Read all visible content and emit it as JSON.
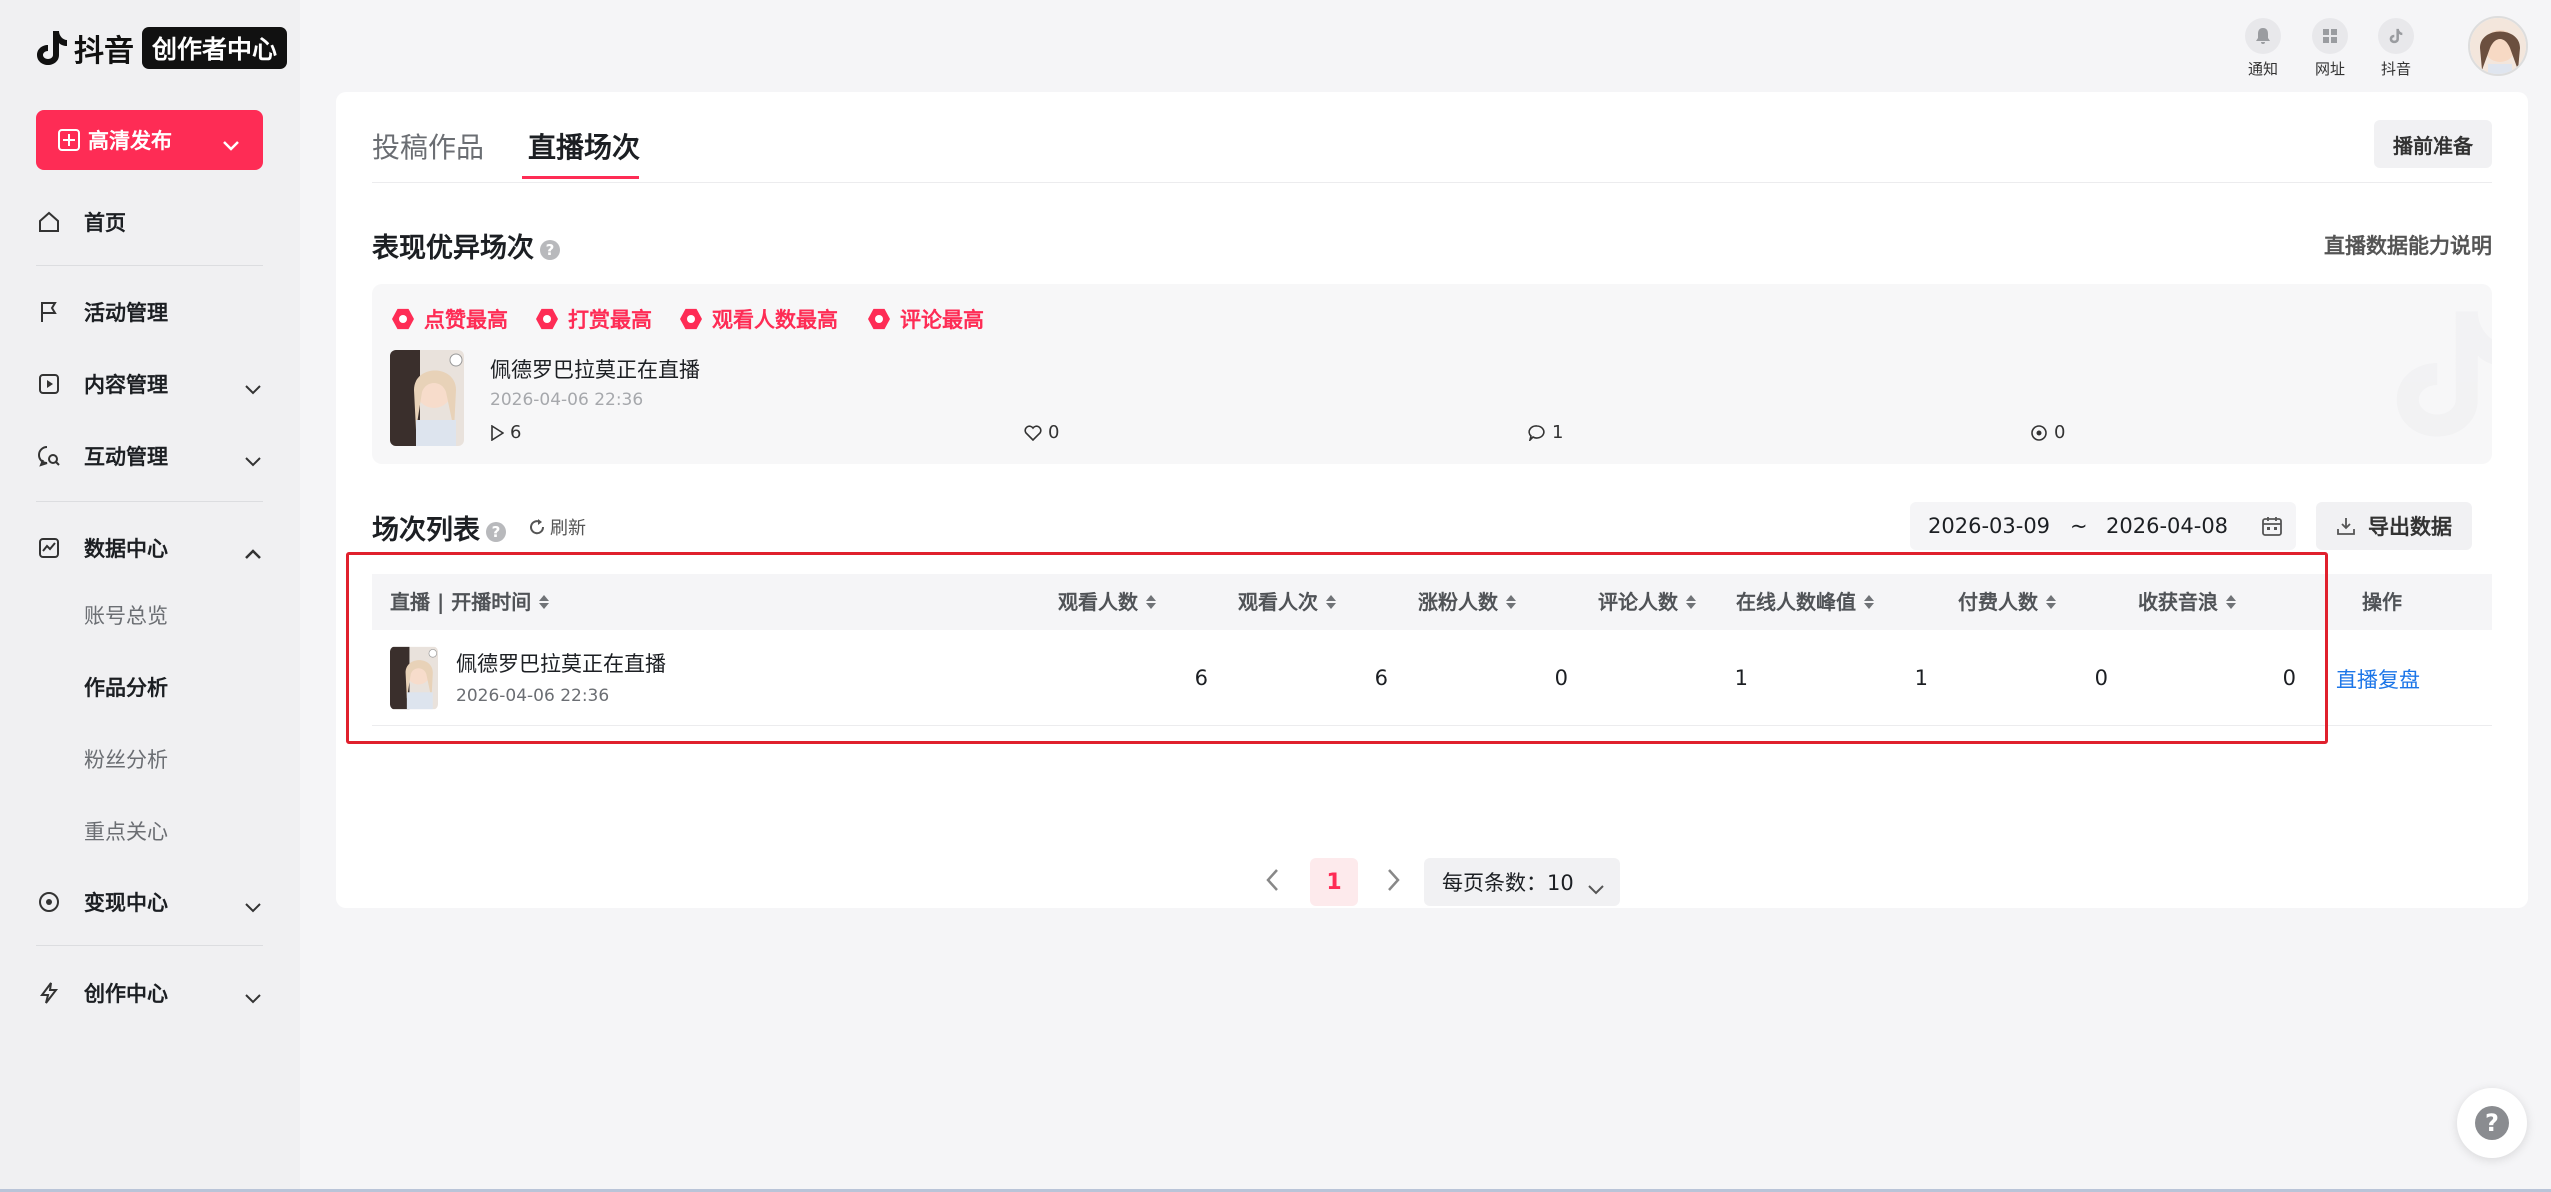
{
  "brand": {
    "name": "抖音",
    "badge": "创作者中心"
  },
  "publish_button": {
    "label": "高清发布"
  },
  "sidebar": {
    "items": [
      {
        "label": "首页",
        "icon": "home-icon"
      },
      {
        "label": "活动管理",
        "icon": "flag-icon"
      },
      {
        "label": "内容管理",
        "icon": "play-square-icon"
      },
      {
        "label": "互动管理",
        "icon": "chat-search-icon"
      },
      {
        "label": "数据中心",
        "icon": "chart-icon"
      },
      {
        "label": "变现中心",
        "icon": "target-icon"
      },
      {
        "label": "创作中心",
        "icon": "lightning-icon"
      }
    ],
    "data_center_sub": [
      {
        "label": "账号总览"
      },
      {
        "label": "作品分析"
      },
      {
        "label": "粉丝分析"
      },
      {
        "label": "重点关心"
      }
    ]
  },
  "header": {
    "icons": [
      {
        "label": "通知",
        "icon": "bell-icon"
      },
      {
        "label": "网址",
        "icon": "grid-icon"
      },
      {
        "label": "抖音",
        "icon": "tiktok-icon"
      }
    ]
  },
  "tabs": [
    {
      "label": "投稿作品"
    },
    {
      "label": "直播场次"
    }
  ],
  "prep_button": {
    "label": "播前准备"
  },
  "best_section": {
    "title": "表现优异场次",
    "explain_link": "直播数据能力说明",
    "tags": [
      {
        "label": "点赞最高"
      },
      {
        "label": "打赏最高"
      },
      {
        "label": "观看人数最高"
      },
      {
        "label": "评论最高"
      }
    ],
    "item": {
      "name": "佩德罗巴拉莫正在直播",
      "time": "2026-04-06 22:36",
      "stats": [
        {
          "icon": "play-icon",
          "value": "6"
        },
        {
          "icon": "heart-icon",
          "value": "0"
        },
        {
          "icon": "comment-icon",
          "value": "1"
        },
        {
          "icon": "coin-icon",
          "value": "0"
        }
      ]
    }
  },
  "list_section": {
    "title": "场次列表",
    "refresh_label": "刷新",
    "date_start": "2026-03-09",
    "date_sep": "~",
    "date_end": "2026-04-08",
    "export_label": "导出数据",
    "columns": [
      "直播 | 开播时间",
      "观看人数",
      "观看人次",
      "涨粉人数",
      "评论人数",
      "在线人数峰值",
      "付费人数",
      "收获音浪",
      "操作"
    ],
    "rows": [
      {
        "name": "佩德罗巴拉莫正在直播",
        "time": "2026-04-06 22:36",
        "values": [
          "6",
          "6",
          "0",
          "1",
          "1",
          "0",
          "0"
        ],
        "action": "直播复盘"
      }
    ]
  },
  "pagination": {
    "current": "1",
    "page_size_label": "每页条数：10"
  },
  "colors": {
    "accent": "#fe2c55",
    "link": "#1c76e8",
    "highlight_box": "#e0202d"
  }
}
